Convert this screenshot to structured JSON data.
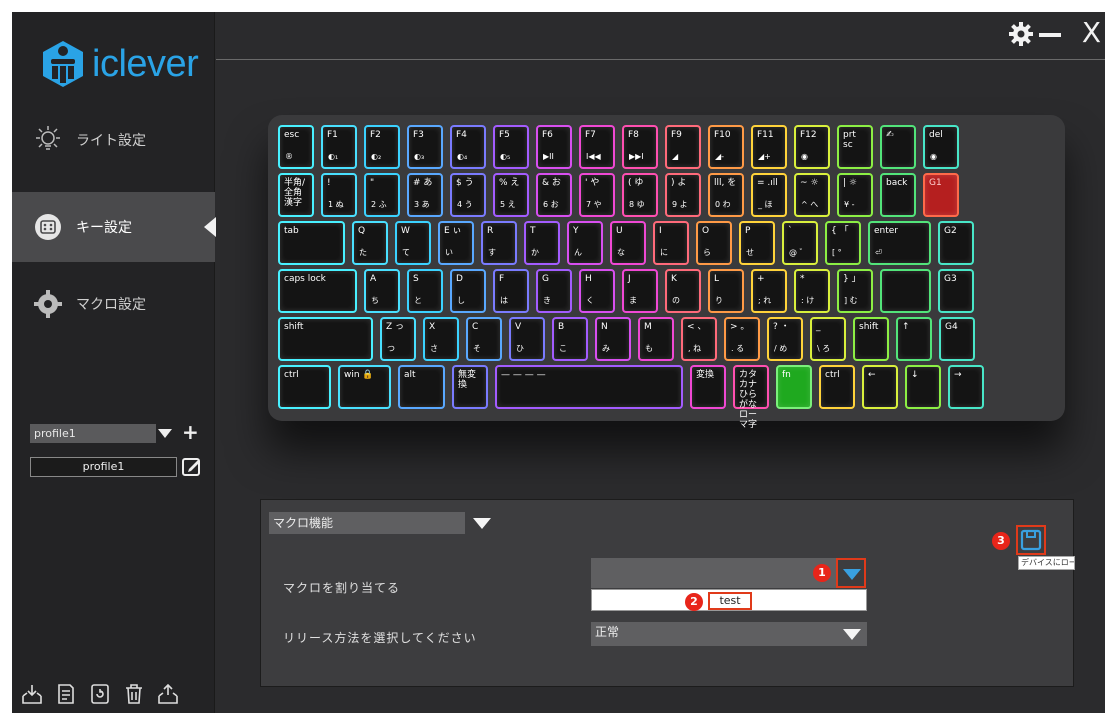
{
  "brand": "iclever",
  "sidebar": {
    "items": [
      {
        "label": "ライト設定"
      },
      {
        "label": "キー設定"
      },
      {
        "label": "マクロ設定"
      }
    ],
    "profile_select": "profile1",
    "profile_add": "+",
    "profile_name": "profile1"
  },
  "window": {
    "close": "X"
  },
  "keyboard": {
    "row1": [
      {
        "l": "esc",
        "s": "®"
      },
      {
        "l": "F1",
        "s": "◐₁"
      },
      {
        "l": "F2",
        "s": "◐₂"
      },
      {
        "l": "F3",
        "s": "◐₃"
      },
      {
        "l": "F4",
        "s": "◐₄"
      },
      {
        "l": "F5",
        "s": "◐₅"
      },
      {
        "l": "F6",
        "s": "▶II"
      },
      {
        "l": "F7",
        "s": "I◀◀"
      },
      {
        "l": "F8",
        "s": "▶▶I"
      },
      {
        "l": "F9",
        "s": "◢"
      },
      {
        "l": "F10",
        "s": "◢-"
      },
      {
        "l": "F11",
        "s": "◢+"
      },
      {
        "l": "F12",
        "s": "◉"
      },
      {
        "l": "prt sc",
        "s": ""
      },
      {
        "l": "✍",
        "s": ""
      },
      {
        "l": "del",
        "s": "◉"
      }
    ],
    "row2": [
      {
        "l": "半角/全角漢字",
        "s": ""
      },
      {
        "l": "!",
        "s": "1 ぬ"
      },
      {
        "l": "\"",
        "s": "2 ふ"
      },
      {
        "l": "# あ",
        "s": "3 あ"
      },
      {
        "l": "$ う",
        "s": "4 う"
      },
      {
        "l": "% え",
        "s": "5 え"
      },
      {
        "l": "& お",
        "s": "6 お"
      },
      {
        "l": "' や",
        "s": "7 や"
      },
      {
        "l": "( ゆ",
        "s": "8 ゆ"
      },
      {
        "l": ") よ",
        "s": "9 よ"
      },
      {
        "l": "lll, を",
        "s": "0 わ"
      },
      {
        "l": "= .ıll",
        "s": "_ ほ"
      },
      {
        "l": "~ ☼",
        "s": "^ へ"
      },
      {
        "l": "| ☼",
        "s": "¥ -"
      },
      {
        "l": "back",
        "s": ""
      },
      {
        "l": "G1",
        "s": ""
      }
    ],
    "row3": [
      {
        "l": "tab",
        "s": ""
      },
      {
        "l": "Q",
        "s": "た"
      },
      {
        "l": "W",
        "s": "て"
      },
      {
        "l": "E ぃ",
        "s": "い"
      },
      {
        "l": "R",
        "s": "す"
      },
      {
        "l": "T",
        "s": "か"
      },
      {
        "l": "Y",
        "s": "ん"
      },
      {
        "l": "U",
        "s": "な"
      },
      {
        "l": "I",
        "s": "に"
      },
      {
        "l": "O",
        "s": "ら"
      },
      {
        "l": "P",
        "s": "せ"
      },
      {
        "l": "`",
        "s": "@ ゛"
      },
      {
        "l": "{ 「",
        "s": "[ °"
      },
      {
        "l": "enter",
        "s": "⏎"
      },
      {
        "l": "G2",
        "s": ""
      }
    ],
    "row4": [
      {
        "l": "caps lock",
        "s": ""
      },
      {
        "l": "A",
        "s": "ち"
      },
      {
        "l": "S",
        "s": "と"
      },
      {
        "l": "D",
        "s": "し"
      },
      {
        "l": "F",
        "s": "は"
      },
      {
        "l": "G",
        "s": "き"
      },
      {
        "l": "H",
        "s": "く"
      },
      {
        "l": "J",
        "s": "ま"
      },
      {
        "l": "K",
        "s": "の"
      },
      {
        "l": "L",
        "s": "り"
      },
      {
        "l": "+",
        "s": "; れ"
      },
      {
        "l": "*",
        "s": ": け"
      },
      {
        "l": "} 」",
        "s": "] む"
      },
      {
        "l": "",
        "s": ""
      },
      {
        "l": "G3",
        "s": ""
      }
    ],
    "row5": [
      {
        "l": "shift",
        "s": ""
      },
      {
        "l": "Z っ",
        "s": "つ"
      },
      {
        "l": "X",
        "s": "さ"
      },
      {
        "l": "C",
        "s": "そ"
      },
      {
        "l": "V",
        "s": "ひ"
      },
      {
        "l": "B",
        "s": "こ"
      },
      {
        "l": "N",
        "s": "み"
      },
      {
        "l": "M",
        "s": "も"
      },
      {
        "l": "< 、",
        "s": ", ね"
      },
      {
        "l": "> 。",
        "s": ". る"
      },
      {
        "l": "? ・",
        "s": "/ め"
      },
      {
        "l": "_",
        "s": "\\ ろ"
      },
      {
        "l": "shift",
        "s": ""
      },
      {
        "l": "↑",
        "s": ""
      },
      {
        "l": "G4",
        "s": ""
      }
    ],
    "row6": [
      {
        "l": "ctrl",
        "s": ""
      },
      {
        "l": "win 🔒",
        "s": ""
      },
      {
        "l": "alt",
        "s": ""
      },
      {
        "l": "無変換",
        "s": ""
      },
      {
        "l": "— — — —",
        "s": ""
      },
      {
        "l": "変換",
        "s": ""
      },
      {
        "l": "カタカナひらがなローマ字",
        "s": ""
      },
      {
        "l": "fn",
        "s": ""
      },
      {
        "l": "ctrl",
        "s": ""
      },
      {
        "l": "←",
        "s": ""
      },
      {
        "l": "↓",
        "s": ""
      },
      {
        "l": "→",
        "s": ""
      }
    ]
  },
  "macro": {
    "function_select": "マクロ機能",
    "assign_label": "マクロを割り当てる",
    "option_test": "test",
    "release_label": "リリース方法を選択してください",
    "release_value": "正常",
    "tooltip": "デバイスにロードする",
    "badges": [
      "1",
      "2",
      "3"
    ]
  }
}
